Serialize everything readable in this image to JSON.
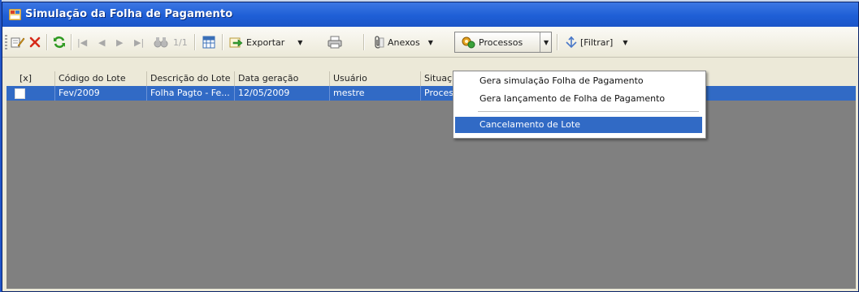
{
  "window": {
    "title": "Simulação da Folha de Pagamento"
  },
  "toolbar": {
    "record_position": "1/1",
    "exportar_label": "Exportar",
    "anexos_label": "Anexos",
    "processos_label": "Processos",
    "filtrar_label": "[Filtrar]"
  },
  "grid": {
    "columns": [
      "[x]",
      "Código do Lote",
      "Descrição do Lote",
      "Data geração",
      "Usuário",
      "Situaç"
    ],
    "rows": [
      {
        "codigo": "Fev/2009",
        "descricao": "Folha Pagto - Fe...",
        "data": "12/05/2009",
        "usuario": "mestre",
        "situacao": "Proces"
      }
    ]
  },
  "processos_menu": {
    "items": [
      "Gera simulação Folha de Pagamento",
      "Gera lançamento de Folha de Pagamento",
      "Cancelamento de Lote"
    ],
    "highlighted": "Cancelamento de Lote"
  },
  "colors": {
    "titlebar": "#1e5fd6",
    "selection": "#316ac5",
    "grid_background": "#808080"
  }
}
